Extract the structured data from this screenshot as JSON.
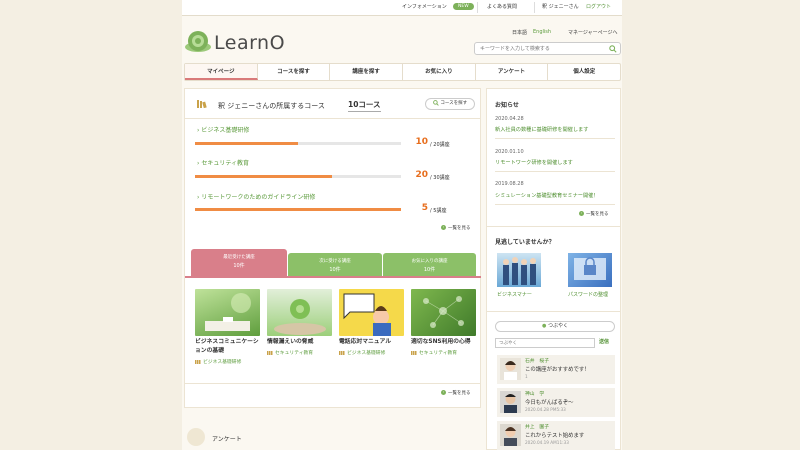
{
  "topbar": {
    "info": "インフォメーション",
    "new_badge": "NEW",
    "faq": "よくある質問",
    "user": "釈 ジェニーさん",
    "logout": "ログアウト"
  },
  "brand": {
    "logo_text": "LearnO"
  },
  "lang": {
    "ja": "日本語",
    "en": "English",
    "manager": "マネージャーページへ"
  },
  "search": {
    "placeholder": "キーワードを入力して検索する"
  },
  "nav": {
    "items": [
      {
        "label": "マイページ"
      },
      {
        "label": "コースを探す"
      },
      {
        "label": "講座を探す"
      },
      {
        "label": "お気に入り"
      },
      {
        "label": "アンケート"
      },
      {
        "label": "個人設定"
      }
    ]
  },
  "courses": {
    "heading": "釈 ジェニーさんの所属するコース",
    "count": "10コース",
    "find_button": "コースを探す",
    "more": "一覧を見る",
    "items": [
      {
        "title": "ビジネス基礎研修",
        "done": "10",
        "total": "/ 20講座",
        "progress": 0.5
      },
      {
        "title": "セキュリティ教育",
        "done": "20",
        "total": "/ 30講座",
        "progress": 0.667
      },
      {
        "title": "リモートワークのためのガイドライン研修",
        "done": "5",
        "total": "/ 5講座",
        "progress": 1.0
      }
    ]
  },
  "lectures": {
    "tabs": [
      {
        "label": "最近受けた講座",
        "count": "10件"
      },
      {
        "label": "次に受ける講座",
        "count": "10件"
      },
      {
        "label": "お気に入りの講座",
        "count": "10件"
      }
    ],
    "cards": [
      {
        "title": "ビジネスコミュニケーションの基礎",
        "course": "ビジネス基礎研修"
      },
      {
        "title": "情報漏えいの脅威",
        "course": "セキュリティ教育"
      },
      {
        "title": "電話応対マニュアル",
        "course": "ビジネス基礎研修"
      },
      {
        "title": "適切なSNS利用の心得",
        "course": "セキュリティ教育"
      }
    ],
    "more": "一覧を見る"
  },
  "survey": {
    "title": "アンケート"
  },
  "notices": {
    "heading": "お知らせ",
    "items": [
      {
        "date": "2020.04.28",
        "text": "新入社員の数種に基礎研修を開催します"
      },
      {
        "date": "2020.01.10",
        "text": "リモートワーク研修を開催します"
      },
      {
        "date": "2019.08.28",
        "text": "シミュレーション基礎型教育セミナー開催！"
      }
    ],
    "more": "一覧を見る"
  },
  "recommend": {
    "heading": "見逃していませんか？",
    "items": [
      {
        "label": "ビジネスマナー"
      },
      {
        "label": "パスワードの整理"
      }
    ]
  },
  "tweets": {
    "button": "つぶやく",
    "placeholder": "つぶやく",
    "post": "送信",
    "items": [
      {
        "name": "石井　桜子",
        "text": "この講座がおすすめです！",
        "time": "1"
      },
      {
        "name": "神山　学",
        "text": "今日もがんばるぞ～",
        "time": "2020.04.28 PM5:33"
      },
      {
        "name": "井上　園子",
        "text": "これからテスト始めます",
        "time": "2020.04.19 AM11:33"
      }
    ]
  },
  "colors": {
    "accent_green": "#5a9a3a",
    "progress_orange": "#f08c44",
    "tab_pink": "#d97f8a",
    "tab_green": "#8cc068"
  }
}
